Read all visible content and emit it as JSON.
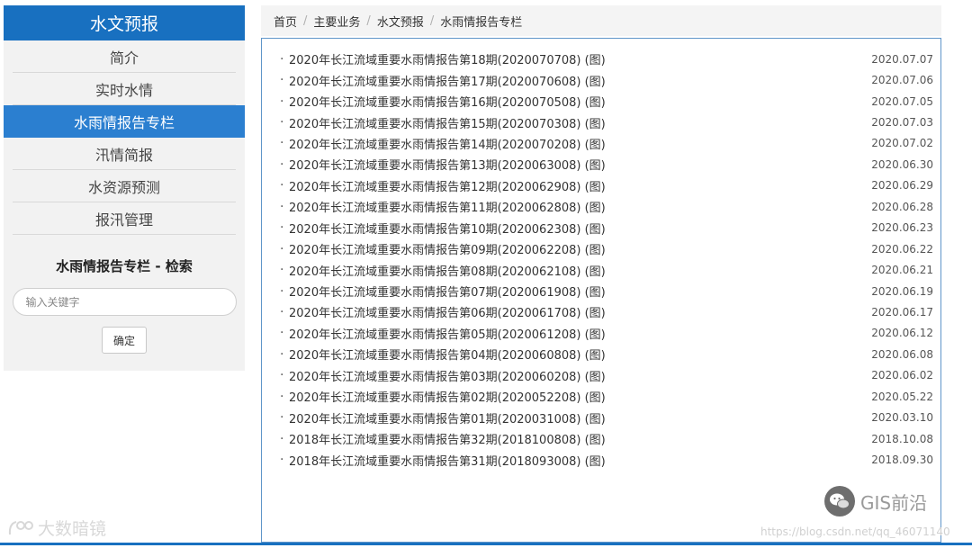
{
  "sidebar": {
    "title": "水文预报",
    "items": [
      {
        "label": "简介"
      },
      {
        "label": "实时水情"
      },
      {
        "label": "水雨情报告专栏"
      },
      {
        "label": "汛情简报"
      },
      {
        "label": "水资源预测"
      },
      {
        "label": "报汛管理"
      }
    ],
    "active_index": 2,
    "search_title": "水雨情报告专栏 - 检索",
    "search_placeholder": "输入关键字",
    "search_button": "确定"
  },
  "breadcrumb": {
    "items": [
      "首页",
      "主要业务",
      "水文预报",
      "水雨情报告专栏"
    ],
    "separator": "/"
  },
  "reports": [
    {
      "title": "2020年长江流域重要水雨情报告第18期(2020070708)  (图)",
      "date": "2020.07.07"
    },
    {
      "title": "2020年长江流域重要水雨情报告第17期(2020070608)  (图)",
      "date": "2020.07.06"
    },
    {
      "title": "2020年长江流域重要水雨情报告第16期(2020070508)  (图)",
      "date": "2020.07.05"
    },
    {
      "title": "2020年长江流域重要水雨情报告第15期(2020070308)  (图)",
      "date": "2020.07.03"
    },
    {
      "title": "2020年长江流域重要水雨情报告第14期(2020070208)  (图)",
      "date": "2020.07.02"
    },
    {
      "title": "2020年长江流域重要水雨情报告第13期(2020063008)  (图)",
      "date": "2020.06.30"
    },
    {
      "title": "2020年长江流域重要水雨情报告第12期(2020062908)  (图)",
      "date": "2020.06.29"
    },
    {
      "title": "2020年长江流域重要水雨情报告第11期(2020062808)  (图)",
      "date": "2020.06.28"
    },
    {
      "title": "2020年长江流域重要水雨情报告第10期(2020062308)  (图)",
      "date": "2020.06.23"
    },
    {
      "title": "2020年长江流域重要水雨情报告第09期(2020062208)  (图)",
      "date": "2020.06.22"
    },
    {
      "title": "2020年长江流域重要水雨情报告第08期(2020062108)  (图)",
      "date": "2020.06.21"
    },
    {
      "title": "2020年长江流域重要水雨情报告第07期(2020061908)  (图)",
      "date": "2020.06.19"
    },
    {
      "title": "2020年长江流域重要水雨情报告第06期(2020061708)  (图)",
      "date": "2020.06.17"
    },
    {
      "title": "2020年长江流域重要水雨情报告第05期(2020061208)  (图)",
      "date": "2020.06.12"
    },
    {
      "title": "2020年长江流域重要水雨情报告第04期(2020060808)  (图)",
      "date": "2020.06.08"
    },
    {
      "title": "2020年长江流域重要水雨情报告第03期(2020060208)  (图)",
      "date": "2020.06.02"
    },
    {
      "title": "2020年长江流域重要水雨情报告第02期(2020052208)  (图)",
      "date": "2020.05.22"
    },
    {
      "title": "2020年长江流域重要水雨情报告第01期(2020031008)  (图)",
      "date": "2020.03.10"
    },
    {
      "title": "2018年长江流域重要水雨情报告第32期(2018100808)  (图)",
      "date": "2018.10.08"
    },
    {
      "title": "2018年长江流域重要水雨情报告第31期(2018093008)  (图)",
      "date": "2018.09.30"
    }
  ],
  "watermarks": {
    "left_text": "大数暗镜",
    "right_text": "GIS前沿",
    "url": "https://blog.csdn.net/qq_46071140"
  },
  "colors": {
    "brand_blue": "#1870c0",
    "active_item": "#2b7fd0",
    "panel_border": "#5f95c9",
    "sidebar_bg": "#f2f2f2"
  }
}
